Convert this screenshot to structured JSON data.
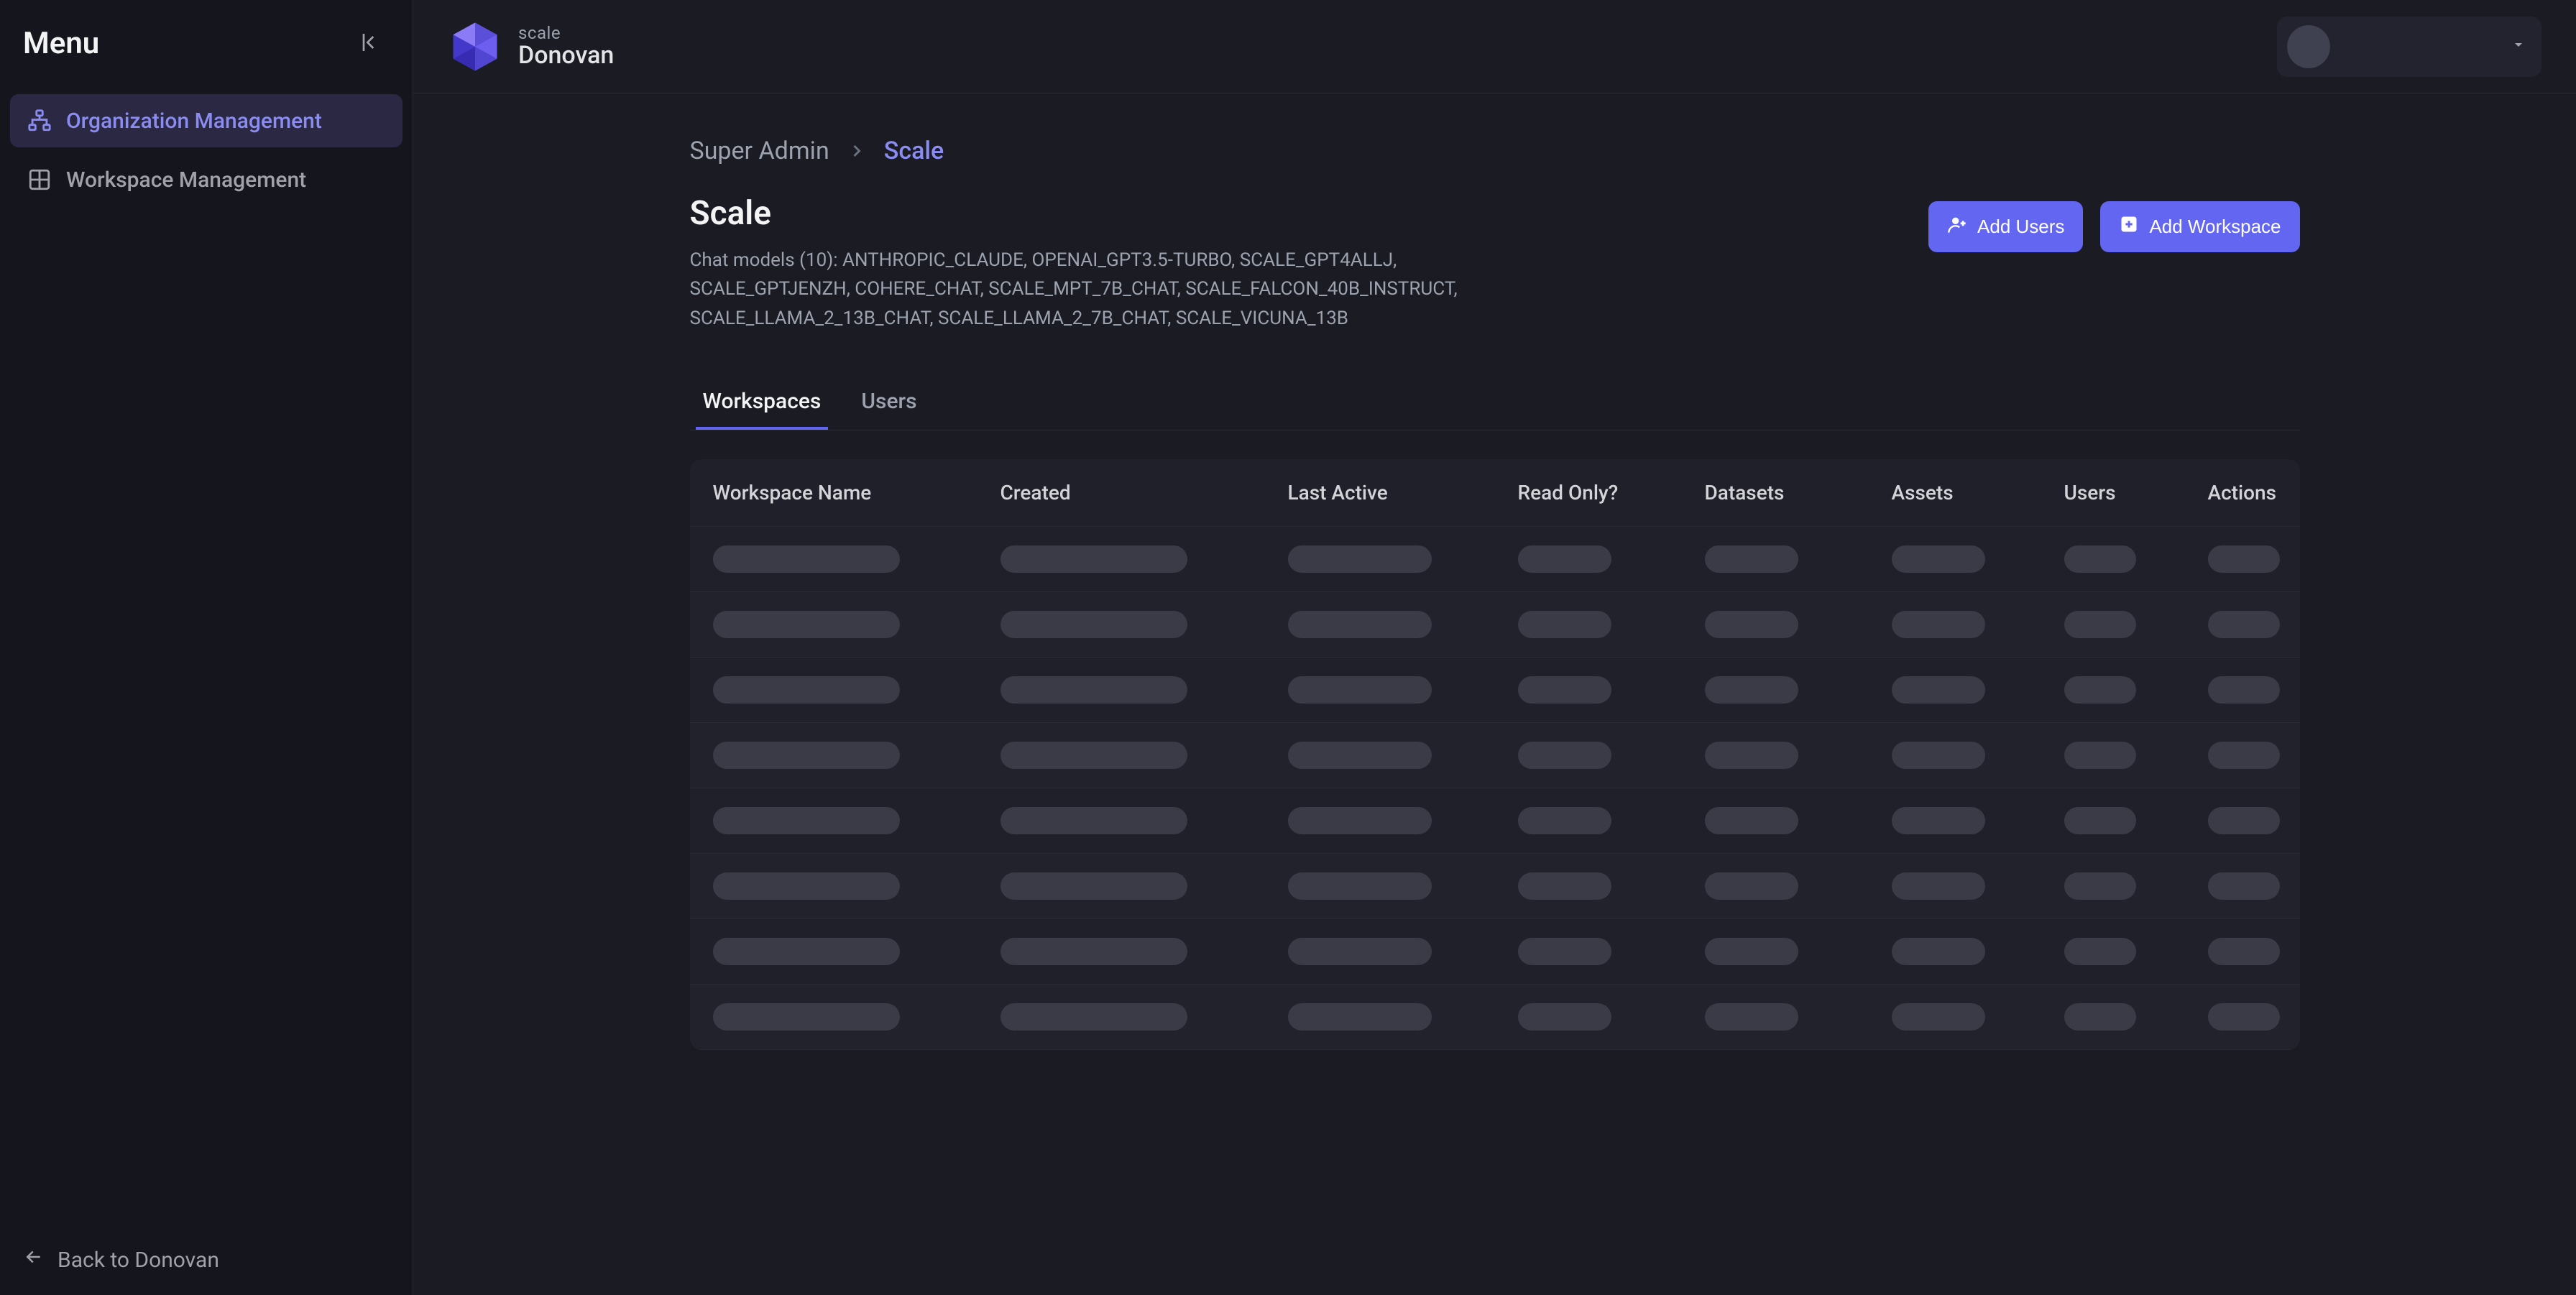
{
  "sidebar": {
    "title": "Menu",
    "items": [
      {
        "label": "Organization Management",
        "icon": "org-chart-icon",
        "active": true
      },
      {
        "label": "Workspace Management",
        "icon": "grid-icon",
        "active": false
      }
    ],
    "back_label": "Back to Donovan"
  },
  "brand": {
    "super": "scale",
    "name": "Donovan"
  },
  "breadcrumb": {
    "root": "Super Admin",
    "leaf": "Scale"
  },
  "page": {
    "title": "Scale",
    "description": "Chat models (10): ANTHROPIC_CLAUDE, OPENAI_GPT3.5-TURBO, SCALE_GPT4ALLJ, SCALE_GPTJENZH, COHERE_CHAT, SCALE_MPT_7B_CHAT, SCALE_FALCON_40B_INSTRUCT, SCALE_LLAMA_2_13B_CHAT, SCALE_LLAMA_2_7B_CHAT, SCALE_VICUNA_13B"
  },
  "actions": {
    "add_users": "Add Users",
    "add_workspace": "Add Workspace"
  },
  "tabs": {
    "workspaces": "Workspaces",
    "users": "Users"
  },
  "table": {
    "columns": {
      "workspace_name": "Workspace Name",
      "created": "Created",
      "last_active": "Last Active",
      "read_only": "Read Only?",
      "datasets": "Datasets",
      "assets": "Assets",
      "users": "Users",
      "actions": "Actions"
    },
    "loading_rows": 8
  },
  "colors": {
    "accent": "#6366f1",
    "accent_text": "#8b8cf2",
    "bg": "#1a1b23",
    "sidebar_bg": "#15161d",
    "surface": "#1f2029"
  }
}
